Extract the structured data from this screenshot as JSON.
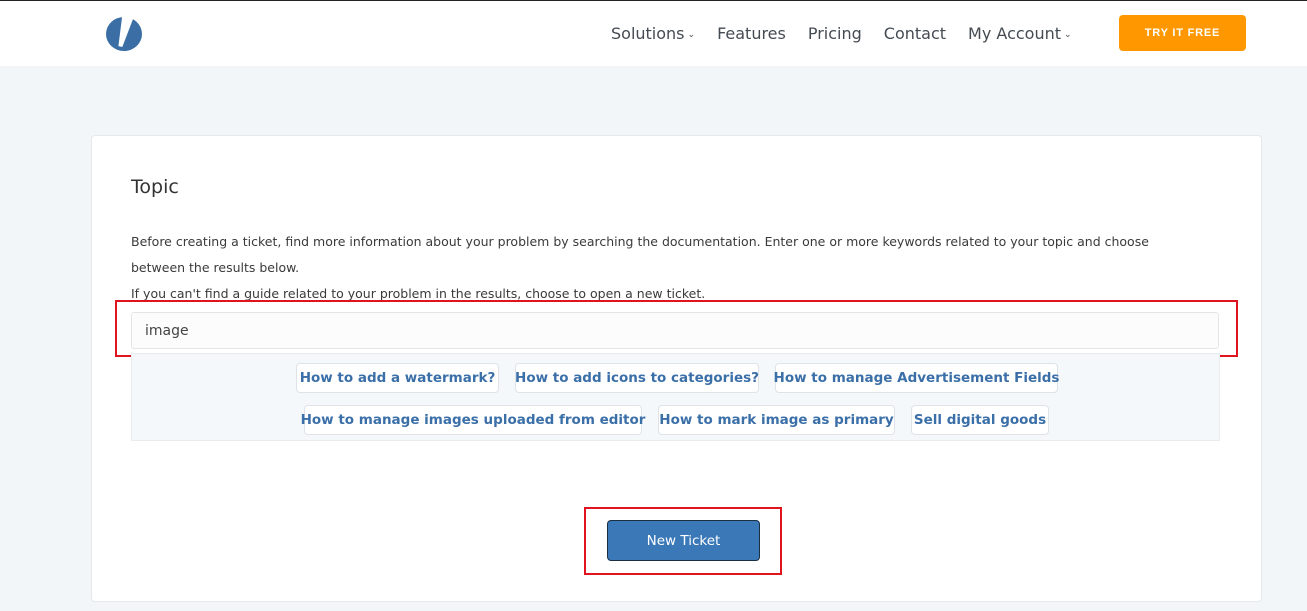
{
  "header": {
    "logo_icon": "brand-logo-icon",
    "nav": [
      {
        "label": "Solutions",
        "dropdown": true
      },
      {
        "label": "Features",
        "dropdown": false
      },
      {
        "label": "Pricing",
        "dropdown": false
      },
      {
        "label": "Contact",
        "dropdown": false
      },
      {
        "label": "My Account",
        "dropdown": true
      }
    ],
    "dropdown_glyph": "⌄",
    "cta_label": "TRY IT FREE"
  },
  "main": {
    "title": "Topic",
    "description_1": "Before creating a ticket, find more information about your problem by searching the documentation. Enter one or more keywords related to your topic and choose between the results below.",
    "description_2": "If you can't find a guide related to your problem in the results, choose to open a new ticket.",
    "search_value": "image",
    "results": [
      "How to add a watermark?",
      "How to add icons to categories?",
      "How to manage Advertisement Fields",
      "How to manage images uploaded from editor",
      "How to mark image as primary",
      "Sell digital goods"
    ],
    "new_ticket_label": "New Ticket"
  },
  "colors": {
    "accent": "#ff9800",
    "link": "#3b6fa8",
    "primary_button": "#3a78b8",
    "highlight": "#e0141e"
  }
}
